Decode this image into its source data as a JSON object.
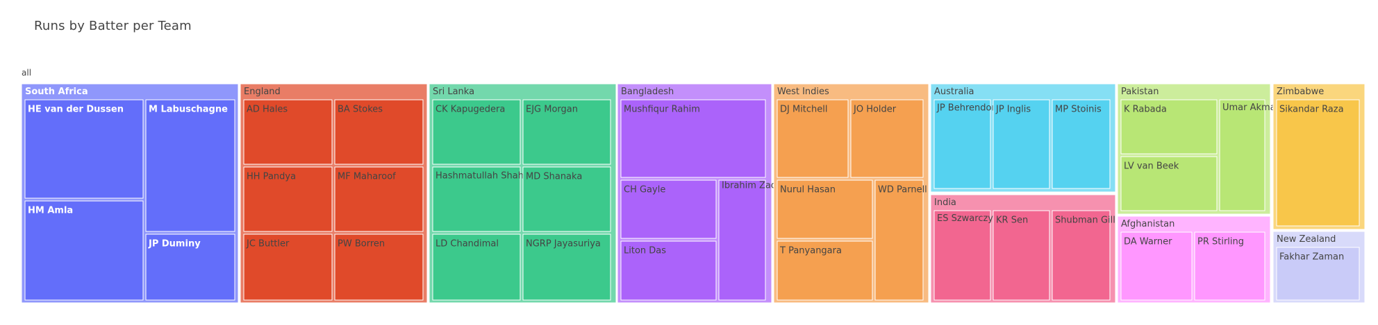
{
  "chart_data": {
    "type": "treemap",
    "title": "Runs by Batter per Team",
    "root_label": "all",
    "teams": [
      {
        "name": "South Africa",
        "color": "#636efa",
        "bold": true,
        "batters": [
          "HE van der Dussen",
          "M Labuschagne",
          "HM Amla",
          "JP Duminy"
        ]
      },
      {
        "name": "England",
        "color": "#e04a2a",
        "batters": [
          "AD Hales",
          "BA Stokes",
          "HH Pandya",
          "MF Maharoof",
          "JC Buttler",
          "PW Borren"
        ]
      },
      {
        "name": "Sri Lanka",
        "color": "#3cc98c",
        "batters": [
          "CK Kapugedera",
          "EJG Morgan",
          "Hashmatullah Shahidi",
          "MD Shanaka",
          "LD Chandimal",
          "NGRP Jayasuriya"
        ]
      },
      {
        "name": "Bangladesh",
        "color": "#ab63fa",
        "batters": [
          "Mushfiqur Rahim",
          "CH Gayle",
          "Liton Das",
          "Ibrahim Zadran"
        ]
      },
      {
        "name": "West Indies",
        "color": "#f5a050",
        "batters": [
          "DJ Mitchell",
          "JO Holder",
          "Nurul Hasan",
          "WD Parnell",
          "T Panyangara"
        ]
      },
      {
        "name": "Australia",
        "color": "#55d2f0",
        "batters": [
          "JP Behrendorff",
          "JP Inglis",
          "MP Stoinis"
        ]
      },
      {
        "name": "India",
        "color": "#f26690",
        "batters": [
          "ES Szwarczynski",
          "KR Sen",
          "Shubman Gill"
        ]
      },
      {
        "name": "Pakistan",
        "color": "#b8e675",
        "batters": [
          "K Rabada",
          "Umar Akmal",
          "LV van Beek"
        ]
      },
      {
        "name": "Afghanistan",
        "color": "#ff97ff",
        "batters": [
          "DA Warner",
          "PR Stirling"
        ]
      },
      {
        "name": "Zimbabwe",
        "color": "#f8c64a",
        "batters": [
          "Sikandar Raza"
        ]
      },
      {
        "name": "New Zealand",
        "color": "#c9cbf8",
        "batters": [
          "Fakhar Zaman"
        ]
      }
    ]
  }
}
